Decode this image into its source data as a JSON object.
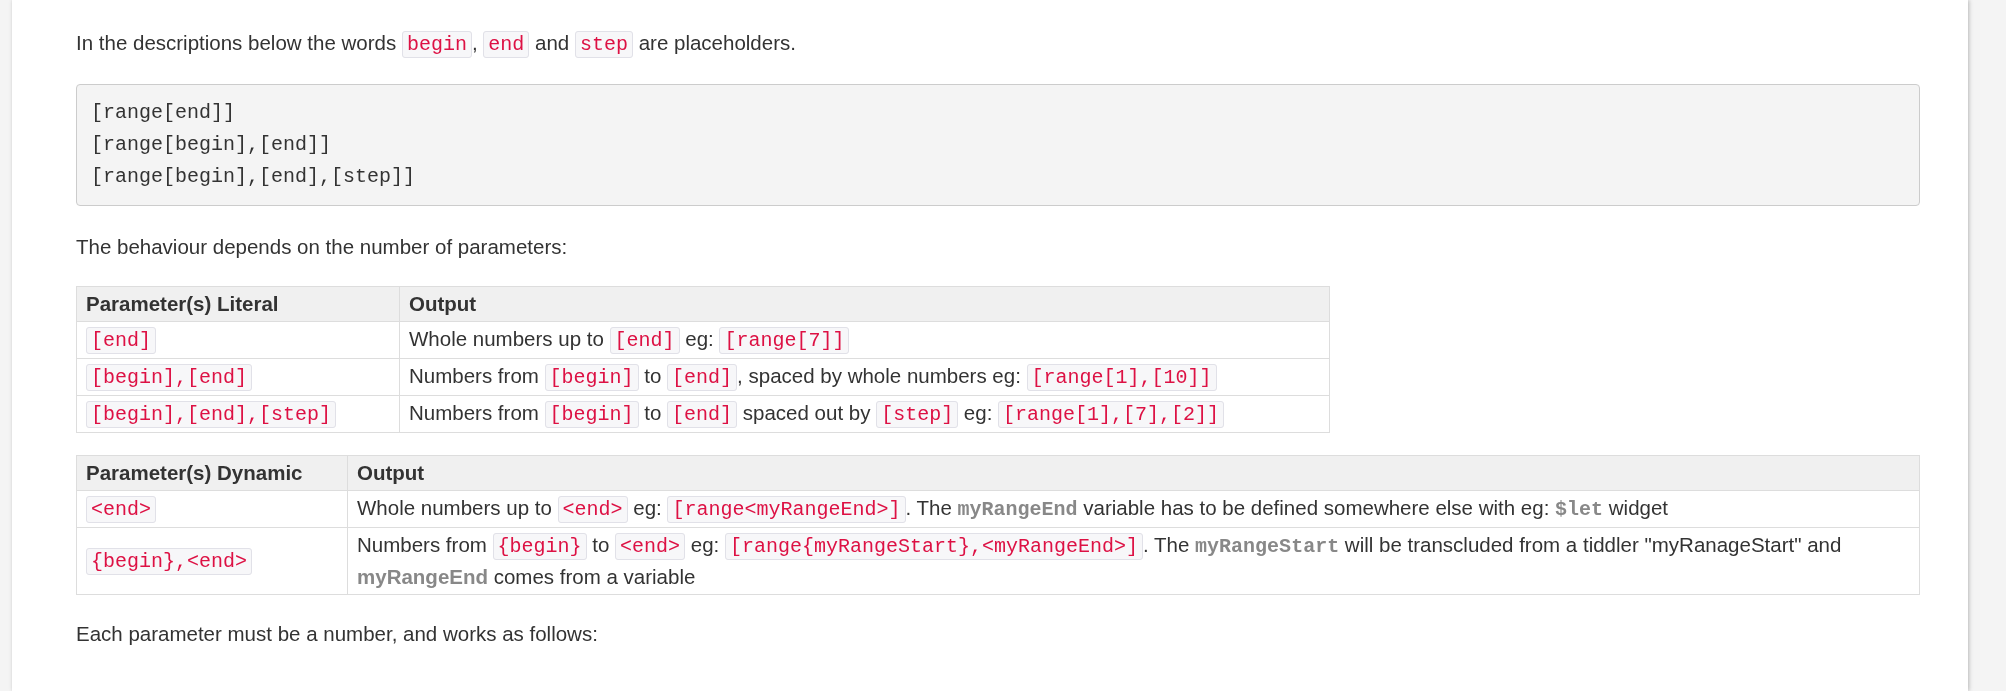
{
  "intro": [
    {
      "kind": "text",
      "text": "In the descriptions below the words "
    },
    {
      "kind": "code",
      "text": "begin"
    },
    {
      "kind": "text",
      "text": ", "
    },
    {
      "kind": "code",
      "text": "end"
    },
    {
      "kind": "text",
      "text": " and "
    },
    {
      "kind": "code",
      "text": "step"
    },
    {
      "kind": "text",
      "text": " are placeholders."
    }
  ],
  "code_block": [
    "[range[end]]",
    "[range[begin],[end]]",
    "[range[begin],[end],[step]]"
  ],
  "behaviour": [
    {
      "kind": "text",
      "text": "The behaviour depends on the number of parameters:"
    }
  ],
  "tables": [
    {
      "columns": [
        "Parameter(s) Literal",
        "Output"
      ],
      "rows": [
        [
          [
            {
              "kind": "code",
              "text": "[end]"
            }
          ],
          [
            {
              "kind": "text",
              "text": "Whole numbers up to "
            },
            {
              "kind": "code",
              "text": "[end]"
            },
            {
              "kind": "text",
              "text": " eg: "
            },
            {
              "kind": "code",
              "text": "[range[7]]"
            }
          ]
        ],
        [
          [
            {
              "kind": "code",
              "text": "[begin],[end]"
            }
          ],
          [
            {
              "kind": "text",
              "text": "Numbers from "
            },
            {
              "kind": "code",
              "text": "[begin]"
            },
            {
              "kind": "text",
              "text": " to "
            },
            {
              "kind": "code",
              "text": "[end]"
            },
            {
              "kind": "text",
              "text": ", spaced by whole numbers eg: "
            },
            {
              "kind": "code",
              "text": "[range[1],[10]]"
            }
          ]
        ],
        [
          [
            {
              "kind": "code",
              "text": "[begin],[end],[step]"
            }
          ],
          [
            {
              "kind": "text",
              "text": "Numbers from "
            },
            {
              "kind": "code",
              "text": "[begin]"
            },
            {
              "kind": "text",
              "text": " to "
            },
            {
              "kind": "code",
              "text": "[end]"
            },
            {
              "kind": "text",
              "text": " spaced out by "
            },
            {
              "kind": "code",
              "text": "[step]"
            },
            {
              "kind": "text",
              "text": " eg: "
            },
            {
              "kind": "code",
              "text": "[range[1],[7],[2]]"
            }
          ]
        ]
      ]
    },
    {
      "columns": [
        "Parameter(s) Dynamic",
        "Output"
      ],
      "rows": [
        [
          [
            {
              "kind": "code",
              "text": "<end>"
            }
          ],
          [
            {
              "kind": "text",
              "text": "Whole numbers up to "
            },
            {
              "kind": "code",
              "text": "<end>"
            },
            {
              "kind": "text",
              "text": " eg: "
            },
            {
              "kind": "code",
              "text": "[range<myRangeEnd>]"
            },
            {
              "kind": "text",
              "text": ". The "
            },
            {
              "kind": "var",
              "text": "myRangeEnd"
            },
            {
              "kind": "text",
              "text": " variable has to be defined somewhere else with eg: "
            },
            {
              "kind": "var",
              "text": "$let"
            },
            {
              "kind": "text",
              "text": " widget"
            }
          ]
        ],
        [
          [
            {
              "kind": "code",
              "text": "{begin},<end>"
            }
          ],
          [
            {
              "kind": "text",
              "text": "Numbers from "
            },
            {
              "kind": "code",
              "text": "{begin}"
            },
            {
              "kind": "text",
              "text": " to "
            },
            {
              "kind": "code",
              "text": "<end>"
            },
            {
              "kind": "text",
              "text": " eg: "
            },
            {
              "kind": "code",
              "text": "[range{myRangeStart},<myRangeEnd>]"
            },
            {
              "kind": "text",
              "text": ". The "
            },
            {
              "kind": "var",
              "text": "myRangeStart"
            },
            {
              "kind": "text",
              "text": " will be transcluded from a tiddler \"myRanageStart\" and "
            },
            {
              "kind": "strong",
              "text": "myRangeEnd"
            },
            {
              "kind": "text",
              "text": " comes from a variable"
            }
          ]
        ]
      ]
    }
  ],
  "outro": [
    {
      "kind": "text",
      "text": "Each parameter must be a number, and works as follows:"
    }
  ]
}
